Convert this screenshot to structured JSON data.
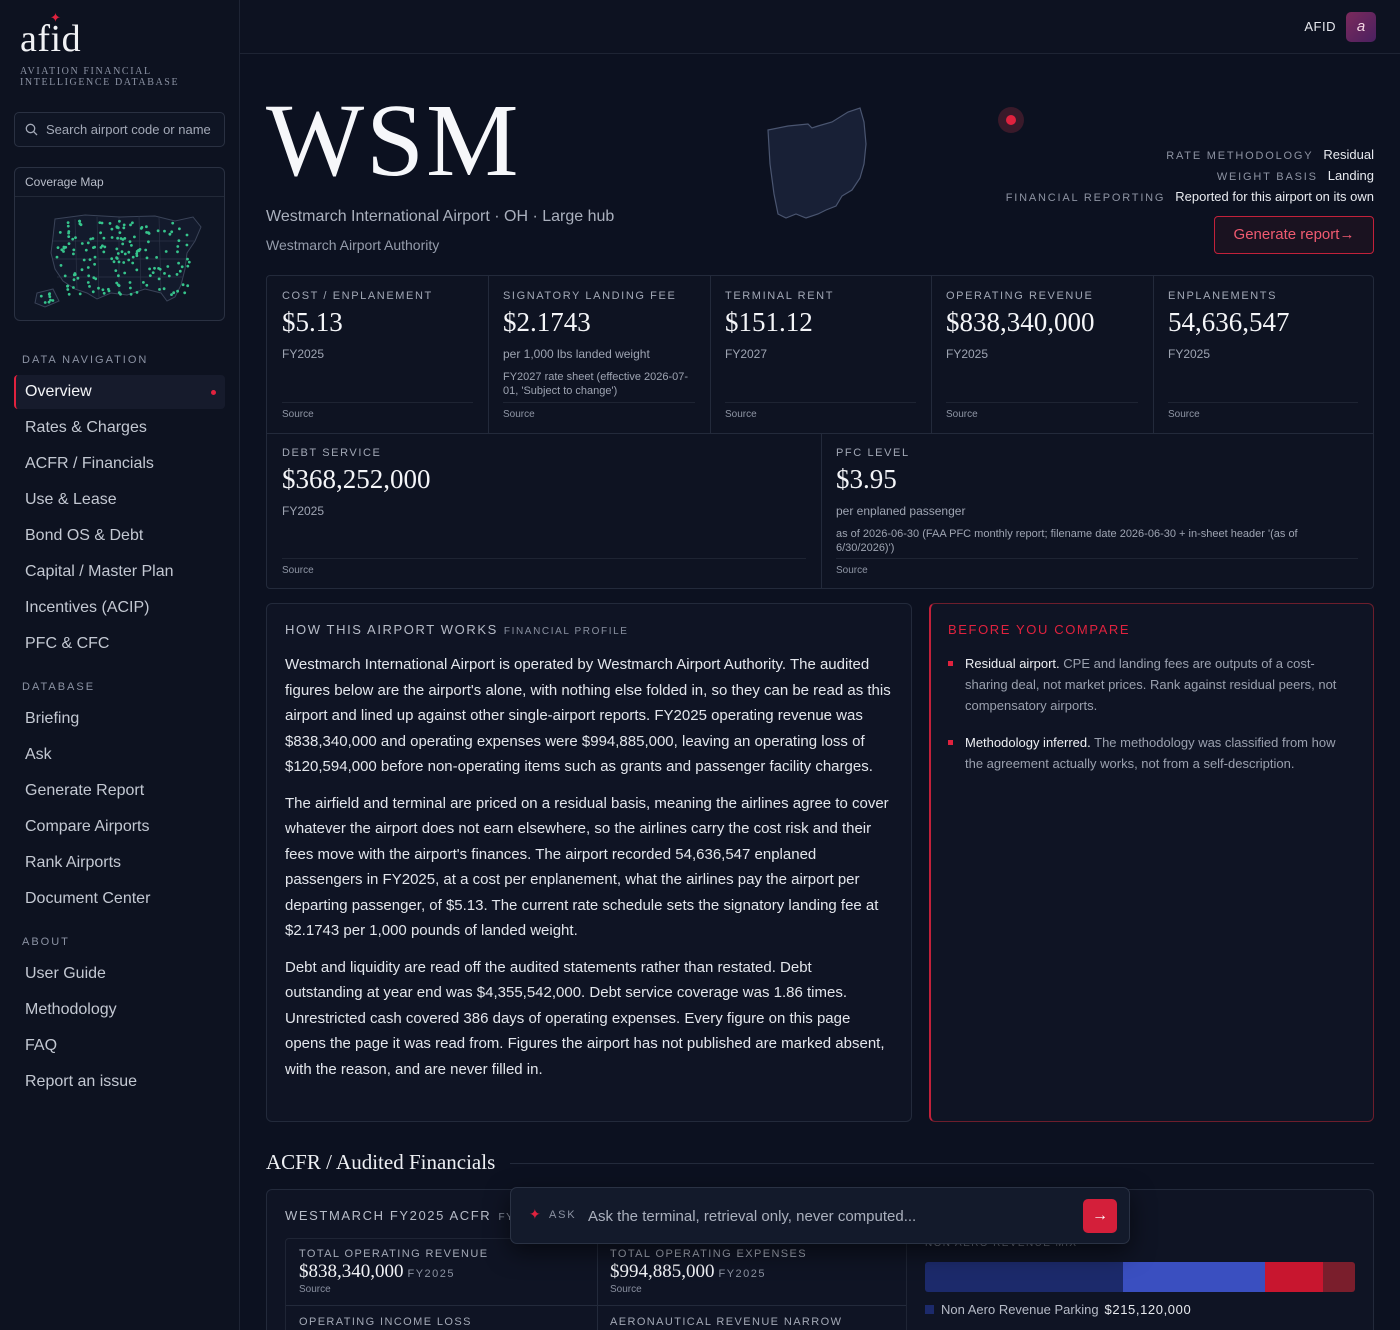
{
  "brand": {
    "logo_word": "afid",
    "logo_sub": "AVIATION FINANCIAL INTELLIGENCE DATABASE",
    "topbar_label": "AFID",
    "avatar_letter": "a",
    "accent": "#e0223e"
  },
  "sidebar": {
    "search_placeholder": "Search airport code or name",
    "coverage_title": "Coverage Map",
    "sections": [
      {
        "title": "DATA NAVIGATION",
        "items": [
          "Overview",
          "Rates & Charges",
          "ACFR / Financials",
          "Use & Lease",
          "Bond OS & Debt",
          "Capital / Master Plan",
          "Incentives (ACIP)",
          "PFC & CFC"
        ]
      },
      {
        "title": "DATABASE",
        "items": [
          "Briefing",
          "Ask",
          "Generate Report",
          "Compare Airports",
          "Rank Airports",
          "Document Center"
        ]
      },
      {
        "title": "ABOUT",
        "items": [
          "User Guide",
          "Methodology",
          "FAQ",
          "Report an issue"
        ]
      }
    ],
    "active_item": "Overview"
  },
  "header": {
    "code": "WSM",
    "name_line": "Westmarch International Airport · OH · Large hub",
    "authority": "Westmarch Airport Authority",
    "meta": [
      {
        "label": "RATE METHODOLOGY",
        "value": "Residual"
      },
      {
        "label": "WEIGHT BASIS",
        "value": "Landing"
      },
      {
        "label": "FINANCIAL REPORTING",
        "value": "Reported for this airport on its own"
      }
    ],
    "generate_button": "Generate report→"
  },
  "kpis": {
    "row1": [
      {
        "label": "COST / ENPLANEMENT",
        "value": "$5.13",
        "sub": "FY2025",
        "note": "",
        "source": "Source"
      },
      {
        "label": "SIGNATORY LANDING FEE",
        "value": "$2.1743",
        "sub": "per 1,000 lbs landed weight",
        "note": "FY2027 rate sheet (effective 2026-07-01, 'Subject to change')",
        "source": "Source"
      },
      {
        "label": "TERMINAL RENT",
        "value": "$151.12",
        "sub": "FY2027",
        "note": "",
        "source": "Source"
      },
      {
        "label": "OPERATING REVENUE",
        "value": "$838,340,000",
        "sub": "FY2025",
        "note": "",
        "source": "Source"
      },
      {
        "label": "ENPLANEMENTS",
        "value": "54,636,547",
        "sub": "FY2025",
        "note": "",
        "source": "Source"
      }
    ],
    "row2": [
      {
        "label": "DEBT SERVICE",
        "value": "$368,252,000",
        "sub": "FY2025",
        "note": "",
        "source": "Source"
      },
      {
        "label": "PFC LEVEL",
        "value": "$3.95",
        "sub": "per enplaned passenger",
        "note": "as of 2026-06-30 (FAA PFC monthly report; filename date 2026-06-30 + in-sheet header '(as of 6/30/2026)')",
        "source": "Source"
      }
    ]
  },
  "profile": {
    "title": "HOW THIS AIRPORT WORKS",
    "tag": "FINANCIAL PROFILE",
    "paragraphs": [
      "Westmarch International Airport is operated by Westmarch Airport Authority. The audited figures below are the airport's alone, with nothing else folded in, so they can be read as this airport and lined up against other single-airport reports. FY2025 operating revenue was $838,340,000 and operating expenses were $994,885,000, leaving an operating loss of $120,594,000 before non-operating items such as grants and passenger facility charges.",
      "The airfield and terminal are priced on a residual basis, meaning the airlines agree to cover whatever the airport does not earn elsewhere, so the airlines carry the cost risk and their fees move with the airport's finances. The airport recorded 54,636,547 enplaned passengers in FY2025, at a cost per enplanement, what the airlines pay the airport per departing passenger, of $5.13. The current rate schedule sets the signatory landing fee at $2.1743 per 1,000 pounds of landed weight.",
      "Debt and liquidity are read off the audited statements rather than restated. Debt outstanding at year end was $4,355,542,000. Debt service coverage was 1.86 times. Unrestricted cash covered 386 days of operating expenses. Every figure on this page opens the page it was read from. Figures the airport has not published are marked absent, with the reason, and are never filled in."
    ]
  },
  "compare": {
    "title": "BEFORE YOU COMPARE",
    "items": [
      {
        "lead": "Residual airport.",
        "text": " CPE and landing fees are outputs of a cost-sharing deal, not market prices. Rank against residual peers, not compensatory airports."
      },
      {
        "lead": "Methodology inferred.",
        "text": " The methodology was classified from how the agreement actually works, not from a self-description."
      }
    ]
  },
  "acfr": {
    "section_title": "ACFR / Audited Financials",
    "panel_title": "WESTMARCH FY2025 ACFR",
    "panel_title_tail": "FY2",
    "cells": [
      {
        "label": "TOTAL OPERATING REVENUE",
        "value": "$838,340,000",
        "fy": "FY2025",
        "source": "Source"
      },
      {
        "label": "TOTAL OPERATING EXPENSES",
        "value": "$994,885,000",
        "fy": "FY2025",
        "source": "Source"
      },
      {
        "label": "OPERATING INCOME LOSS",
        "value": "",
        "fy": "",
        "source": ""
      },
      {
        "label": "AERONAUTICAL REVENUE NARROW",
        "value": "",
        "fy": "",
        "source": ""
      }
    ],
    "mix_title": "NON AERO REVENUE MIX",
    "mix_segments": [
      {
        "share": 0.46,
        "color": "#1c2a6b"
      },
      {
        "share": 0.33,
        "color": "#3a4fc0"
      },
      {
        "share": 0.135,
        "color": "#c8162f"
      },
      {
        "share": 0.075,
        "color": "#7a1e2c"
      }
    ],
    "legend_label": "Non Aero Revenue Parking",
    "legend_value": "$215,120,000"
  },
  "ask": {
    "label": "ASK",
    "placeholder": "Ask the terminal, retrieval only, never computed..."
  }
}
